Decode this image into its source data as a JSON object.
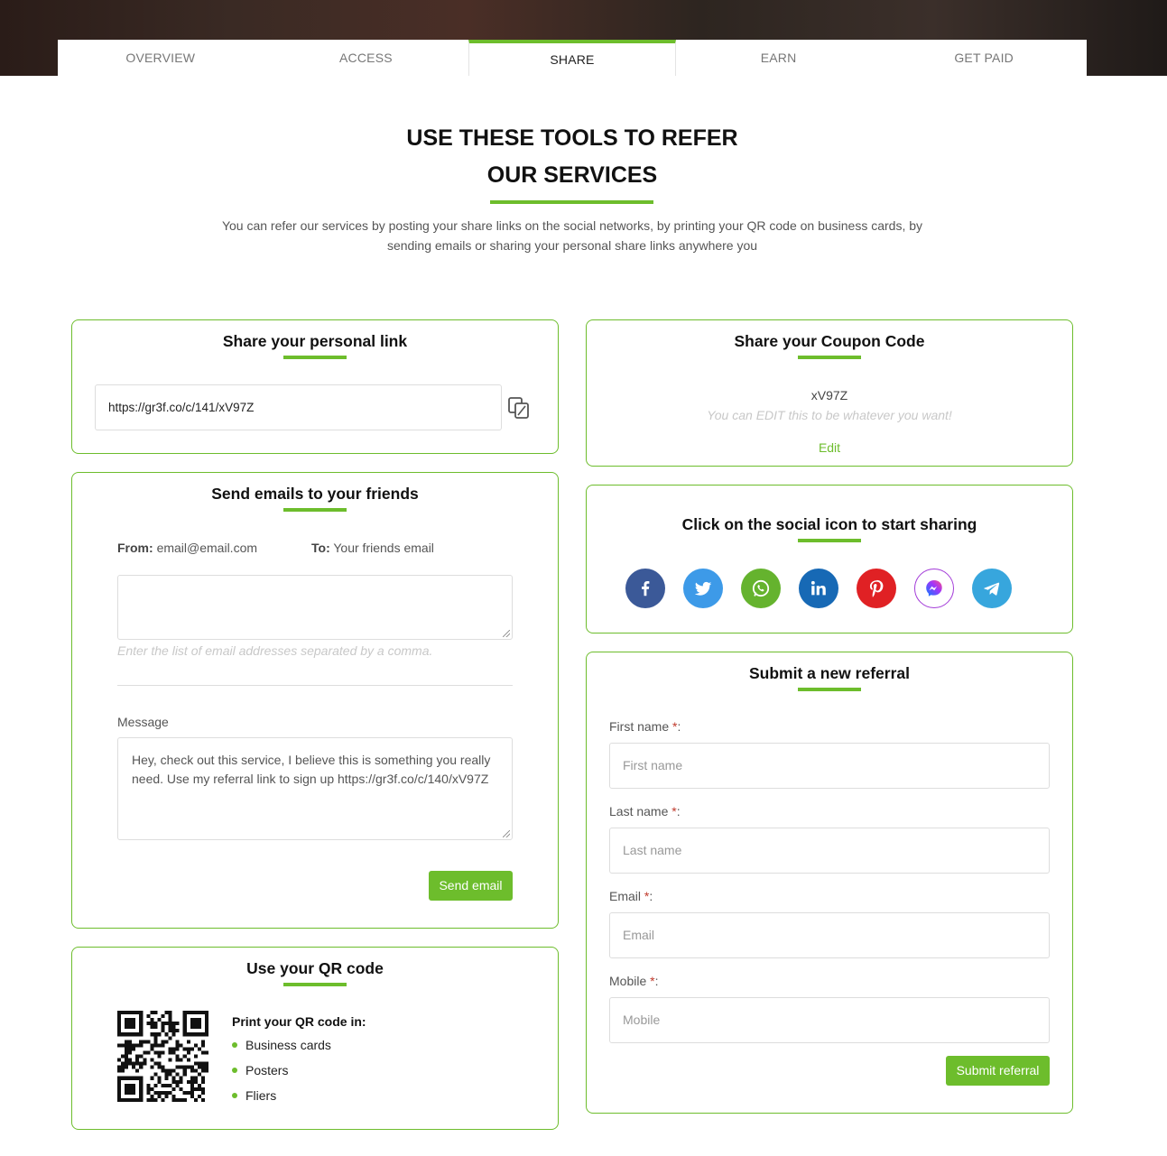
{
  "tabs": [
    "OVERVIEW",
    "ACCESS",
    "SHARE",
    "EARN",
    "GET PAID"
  ],
  "active_tab": "SHARE",
  "heading": {
    "line1": "USE THESE TOOLS TO REFER",
    "line2": "OUR SERVICES"
  },
  "intro": "You can refer our services by posting your share links on the social networks, by printing your QR code on business cards, by sending emails or sharing your personal share links anywhere you",
  "personal_link": {
    "title": "Share your personal link",
    "url": "https://gr3f.co/c/141/xV97Z",
    "copy_icon": "copy-icon"
  },
  "coupon": {
    "title": "Share your Coupon Code",
    "code": "xV97Z",
    "hint": "You can EDIT this to be whatever you want!",
    "edit_label": "Edit"
  },
  "email": {
    "title": "Send emails to your friends",
    "from_label": "From:",
    "from_value": "email@email.com",
    "to_label": "To:",
    "to_value": "Your friends email",
    "recipients_value": "",
    "recipients_hint": "Enter the list of email addresses separated by a comma.",
    "message_label": "Message",
    "message_value": "Hey, check out this service, I believe this is something you really need. Use my referral link to sign up https://gr3f.co/c/140/xV97Z",
    "send_label": "Send email"
  },
  "social": {
    "title": "Click on the social icon to start sharing",
    "icons": [
      {
        "name": "facebook-icon",
        "color": "#3b5998"
      },
      {
        "name": "twitter-icon",
        "color": "#3d9ae8"
      },
      {
        "name": "whatsapp-icon",
        "color": "#65b32e"
      },
      {
        "name": "linkedin-icon",
        "color": "#1769b5"
      },
      {
        "name": "pinterest-icon",
        "color": "#e02124"
      },
      {
        "name": "messenger-icon",
        "color": "#ffffff"
      },
      {
        "name": "telegram-icon",
        "color": "#37a6dd"
      }
    ]
  },
  "referral": {
    "title": "Submit a new referral",
    "fields": [
      {
        "label": "First name",
        "placeholder": "First name"
      },
      {
        "label": "Last name",
        "placeholder": "Last name"
      },
      {
        "label": "Email",
        "placeholder": "Email"
      },
      {
        "label": "Mobile",
        "placeholder": "Mobile"
      }
    ],
    "required_mark": "*",
    "colon": ":",
    "submit_label": "Submit referral"
  },
  "qr": {
    "title": "Use your QR code",
    "print_title": "Print your QR code in:",
    "items": [
      "Business cards",
      "Posters",
      "Fliers"
    ]
  },
  "colors": {
    "accent": "#6dbd2c",
    "required": "#c0392b"
  }
}
